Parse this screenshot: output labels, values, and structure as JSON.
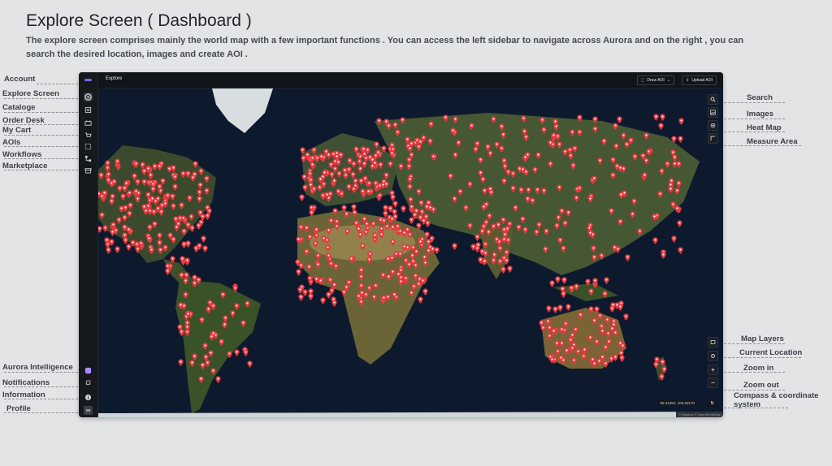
{
  "page": {
    "title": "Explore Screen ( Dashboard )",
    "description": "The explore screen comprises mainly the world map with a few important functions . You can access the left sidebar to navigate across Aurora and on the right , you can search the desired location, images and create AOI ."
  },
  "annotations_left": {
    "account": "Account",
    "explore_screen": "Explore Screen",
    "cataloge": "Cataloge",
    "order_desk": "Order Desk",
    "my_cart": "My Cart",
    "aois": "AOIs",
    "workflows": "Workflows",
    "marketplace": "Marketplace",
    "aurora_intelligence": "Aurora Intelligence",
    "notifications": "Notifications",
    "information": "Information",
    "profile": "Profile"
  },
  "annotations_right": {
    "search": "Search",
    "images": "Images",
    "heat_map": "Heat Map",
    "measure_area": "Measure Area",
    "map_layers": "Map Layers",
    "current_location": "Current Location",
    "zoom_in": "Zoom in",
    "zoom_out": "Zoom out",
    "compass": "Compass & coordinate\nsystem"
  },
  "app": {
    "tab_title": "Explore",
    "draw_aoi_label": "Draw AOI",
    "upload_aoi_label": "Upload AOI",
    "coordinates": "58.41352, 100.63170",
    "compass_label": "N",
    "attribution": "© Mapbox © OpenStreetMap",
    "profile_initials": "SB"
  },
  "colors": {
    "accent": "#7a68ff",
    "pin": "#e8383f",
    "ocean": "#0d1a2e",
    "land": "#3d4a2a"
  },
  "icons": {
    "sidebar": [
      "account-icon",
      "explore-icon",
      "cataloge-icon",
      "order-desk-icon",
      "cart-icon",
      "aois-icon",
      "workflows-icon",
      "marketplace-icon",
      "aurora-intelligence-icon",
      "notifications-icon",
      "information-icon",
      "profile-avatar"
    ],
    "map_tools": [
      "search-icon",
      "images-icon",
      "heat-map-icon",
      "measure-area-icon",
      "map-layers-icon",
      "current-location-icon",
      "zoom-in-icon",
      "zoom-out-icon"
    ]
  }
}
